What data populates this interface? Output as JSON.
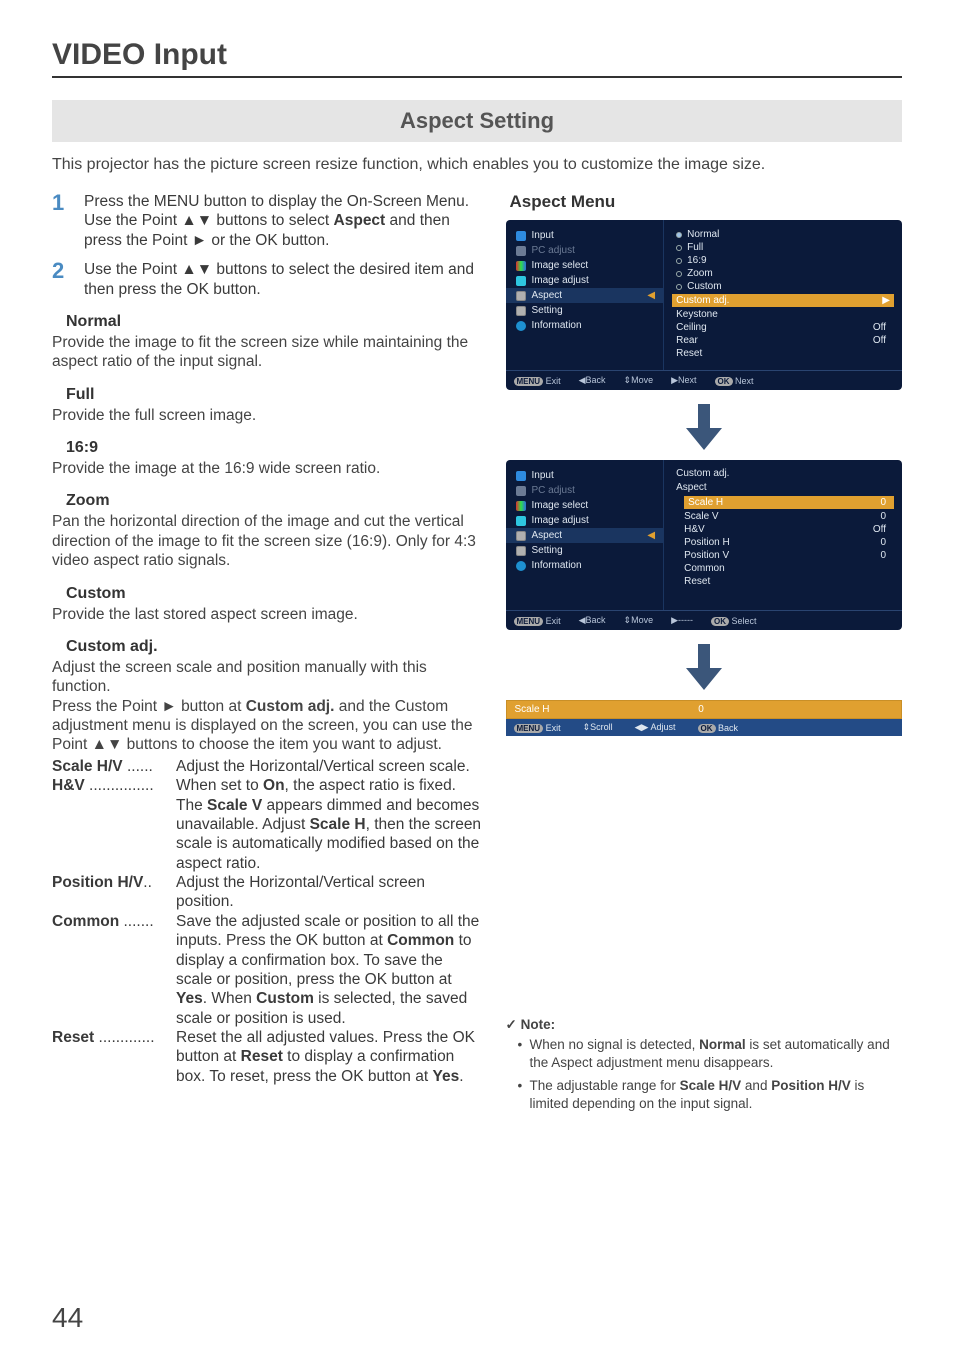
{
  "section_title": "VIDEO Input",
  "banner": "Aspect Setting",
  "intro": "This projector has the picture screen resize function, which enables you to customize the image size.",
  "steps": [
    {
      "num": "1",
      "text_parts": [
        "Press the MENU button to display the On-Screen Menu. Use the Point ▲▼ buttons to select ",
        "Aspect",
        " and then press the Point ► or the OK button."
      ]
    },
    {
      "num": "2",
      "text_parts": [
        "Use the Point ▲▼ buttons to select the desired item and then press the OK button."
      ]
    }
  ],
  "options": {
    "normal": {
      "title": "Normal",
      "desc": "Provide the image to fit the screen size while maintaining the aspect ratio of the input signal."
    },
    "full": {
      "title": "Full",
      "desc": "Provide the full screen image."
    },
    "ratio169": {
      "title": "16:9",
      "desc": "Provide the image at the 16:9 wide screen ratio."
    },
    "zoom": {
      "title": "Zoom",
      "desc": "Pan the horizontal direction of the image and cut the vertical direction of the image to fit the screen size (16:9). Only for 4:3 video aspect ratio signals."
    },
    "custom": {
      "title": "Custom",
      "desc": "Provide the last stored aspect screen image."
    },
    "custom_adj": {
      "title": "Custom adj.",
      "desc_intro": "Adjust the screen scale and position manually with this function.",
      "desc_press_pre": "Press the Point ► button at ",
      "desc_press_bold": "Custom adj.",
      "desc_press_post": " and the Custom adjustment menu is displayed on the screen, you can use the Point ▲▼ buttons to choose the item you want to adjust.",
      "defs": [
        {
          "term": "Scale H/V",
          "dots": " ......",
          "desc_parts": [
            "Adjust the Horizontal/Vertical screen scale."
          ]
        },
        {
          "term": "H&V",
          "dots": " ...............",
          "desc_parts": [
            "When set to ",
            {
              "b": "On"
            },
            ", the aspect ratio is fixed. The ",
            {
              "b": "Scale V"
            },
            " appears dimmed and becomes unavailable. Adjust ",
            {
              "b": "Scale H"
            },
            ", then the screen scale is automatically modified based on the aspect ratio."
          ]
        },
        {
          "term": "Position H/V",
          "dots": "..",
          "desc_parts": [
            "Adjust the Horizontal/Vertical screen position."
          ]
        },
        {
          "term": "Common",
          "dots": " .......",
          "desc_parts": [
            "Save the adjusted scale or position to all the inputs. Press the OK button at ",
            {
              "b": "Common"
            },
            " to display a confirmation box. To save the scale or position, press the OK button at ",
            {
              "b": "Yes"
            },
            ". When ",
            {
              "b": "Custom"
            },
            " is selected, the saved scale or position is used."
          ]
        },
        {
          "term": "Reset",
          "dots": " .............",
          "desc_parts": [
            "Reset the all adjusted values. Press the OK button at ",
            {
              "b": "Reset"
            },
            " to display a confirmation box. To reset, press the OK button at ",
            {
              "b": "Yes"
            },
            "."
          ]
        }
      ]
    }
  },
  "right": {
    "title": "Aspect Menu",
    "osd1": {
      "left_items": [
        {
          "icon": "ic-blue",
          "label": "Input"
        },
        {
          "icon": "ic-gray",
          "label": "PC adjust",
          "dim": true
        },
        {
          "icon": "ic-multi",
          "label": "Image select"
        },
        {
          "icon": "ic-teal",
          "label": "Image adjust"
        },
        {
          "icon": "ic-sq",
          "label": "Aspect",
          "active": true
        },
        {
          "icon": "ic-sq",
          "label": "Setting"
        },
        {
          "icon": "ic-info",
          "label": "Information"
        }
      ],
      "right_rows": [
        {
          "type": "radio",
          "filled": true,
          "label": "Normal"
        },
        {
          "type": "radio",
          "label": "Full"
        },
        {
          "type": "radio",
          "label": "16:9"
        },
        {
          "type": "radio",
          "label": "Zoom"
        },
        {
          "type": "radio",
          "label": "Custom"
        },
        {
          "type": "hl",
          "label": "Custom adj."
        },
        {
          "type": "val",
          "label": "Keystone"
        },
        {
          "type": "val",
          "label": "Ceiling",
          "val": "Off"
        },
        {
          "type": "val",
          "label": "Rear",
          "val": "Off"
        },
        {
          "type": "val",
          "label": "Reset"
        }
      ],
      "foot": [
        {
          "pill": "MENU",
          "label": "Exit"
        },
        {
          "label": "◀Back"
        },
        {
          "label": "⇕Move"
        },
        {
          "label": "▶Next"
        },
        {
          "pill": "OK",
          "label": "Next"
        }
      ]
    },
    "osd2": {
      "left_items_same": true,
      "header1": "Custom adj.",
      "header2": "Aspect",
      "rows": [
        {
          "hl": true,
          "label": "Scale H",
          "val": "0"
        },
        {
          "label": "Scale V",
          "val": "0"
        },
        {
          "label": "H&V",
          "val": "Off"
        },
        {
          "label": "Position H",
          "val": "0"
        },
        {
          "label": "Position V",
          "val": "0"
        },
        {
          "label": "Common"
        },
        {
          "label": "Reset"
        }
      ],
      "foot": [
        {
          "pill": "MENU",
          "label": "Exit"
        },
        {
          "label": "◀Back"
        },
        {
          "label": "⇕Move"
        },
        {
          "label": "▶-----"
        },
        {
          "pill": "OK",
          "label": "Select"
        }
      ]
    },
    "slider": {
      "label": "Scale H",
      "value": "0",
      "foot": [
        {
          "pill": "MENU",
          "label": "Exit"
        },
        {
          "label": "⇕Scroll"
        },
        {
          "label": "◀▶ Adjust"
        },
        {
          "pill": "OK",
          "label": "Back"
        }
      ]
    }
  },
  "note": {
    "title": "Note:",
    "items": [
      {
        "parts": [
          "When no signal is detected, ",
          {
            "b": "Normal"
          },
          " is set automatically and the Aspect adjustment menu disappears."
        ]
      },
      {
        "parts": [
          "The adjustable range for ",
          {
            "b": "Scale H/V"
          },
          " and ",
          {
            "b": "Position H/V"
          },
          " is limited depending on the input signal."
        ]
      }
    ]
  },
  "page_number": "44"
}
